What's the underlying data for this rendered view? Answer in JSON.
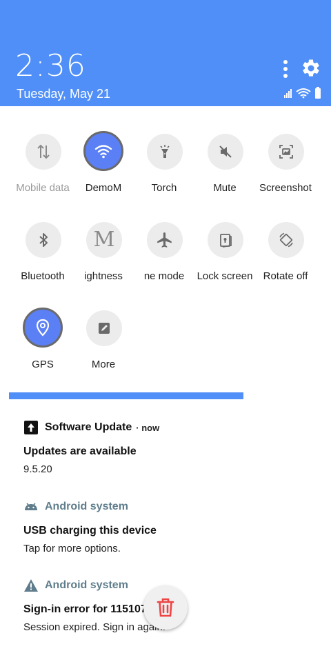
{
  "header": {
    "time": "2:36",
    "date": "Tuesday, May 21",
    "background": "#4f8ff7"
  },
  "tiles": [
    {
      "label": "Mobile data",
      "icon": "mobile-data-icon",
      "active": false
    },
    {
      "label": "DemoM",
      "icon": "wifi-icon",
      "active": true
    },
    {
      "label": "Torch",
      "icon": "torch-icon",
      "active": false
    },
    {
      "label": "Mute",
      "icon": "mute-icon",
      "active": false
    },
    {
      "label": "Screenshot",
      "icon": "screenshot-icon",
      "active": false
    },
    {
      "label": "Bluetooth",
      "icon": "bluetooth-icon",
      "active": false
    },
    {
      "label": "ightness",
      "icon": "brightness-icon",
      "active": false
    },
    {
      "label": "ne mode",
      "icon": "airplane-icon",
      "active": false
    },
    {
      "label": "Lock screen",
      "icon": "lock-screen-icon",
      "active": false
    },
    {
      "label": "Rotate off",
      "icon": "rotate-icon",
      "active": false
    },
    {
      "label": "GPS",
      "icon": "location-icon",
      "active": true
    },
    {
      "label": "More",
      "icon": "edit-icon",
      "active": false
    }
  ],
  "notifications": [
    {
      "app": "Software Update",
      "time": "now",
      "title": "Updates are available",
      "body": "9.5.20"
    },
    {
      "app": "Android system",
      "title": "USB charging this device",
      "body": "Tap for more options."
    },
    {
      "app": "Android system",
      "title": "Sign-in error for 115107",
      "body": "Session expired. Sign in again."
    }
  ],
  "colors": {
    "accent": "#4f8ff7",
    "active_tile": "#5b7ff5",
    "android_label": "#5f7d8c",
    "trash": "#ef4444"
  }
}
